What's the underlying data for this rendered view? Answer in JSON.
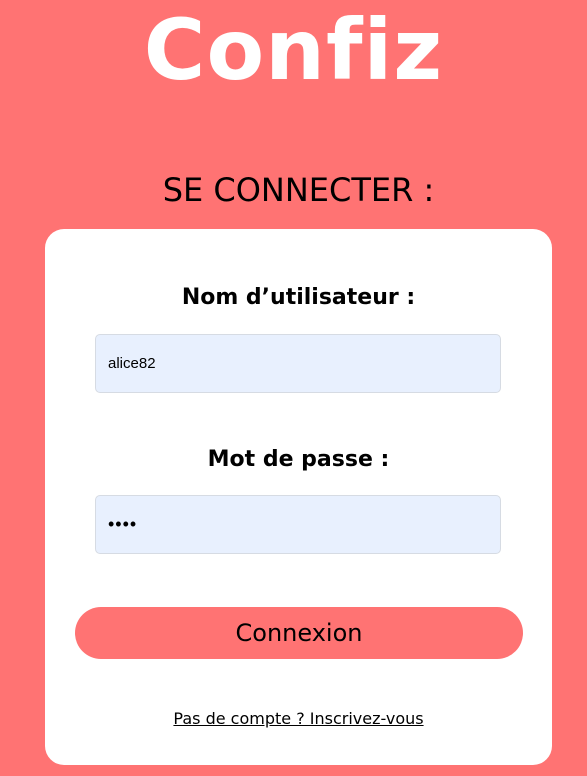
{
  "app": {
    "logo_text": "Confiz"
  },
  "header": {
    "title": "SE CONNECTER :"
  },
  "login_form": {
    "username_label": "Nom d’utilisateur :",
    "username_value": "alice82",
    "password_label": "Mot de passe :",
    "password_value": "••••",
    "submit_label": "Connexion",
    "signup_link_label": "Pas de compte ? Inscrivez-vous"
  },
  "colors": {
    "brand_background": "#ff7373",
    "card_background": "#ffffff",
    "input_background": "#e8f0fe",
    "logo_text": "#ffffff"
  }
}
